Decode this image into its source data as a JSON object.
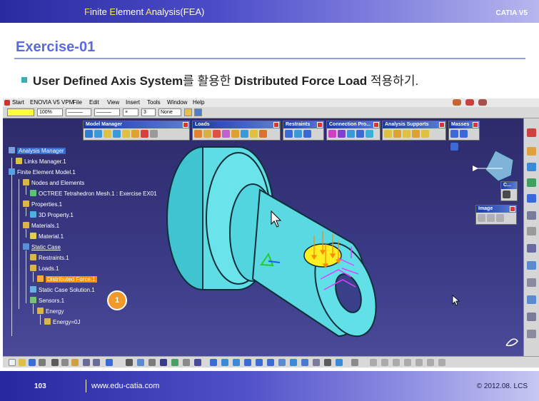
{
  "slide": {
    "header_title_parts": [
      {
        "text": "F",
        "hl": true
      },
      {
        "text": "inite ",
        "hl": false
      },
      {
        "text": "E",
        "hl": true
      },
      {
        "text": "lement ",
        "hl": false
      },
      {
        "text": "A",
        "hl": true
      },
      {
        "text": "nalysis(FEA)",
        "hl": false
      }
    ],
    "brand": "CATIA V5",
    "exercise_title": "Exercise-01",
    "bullet": {
      "part1": "User Defined Axis System",
      "part2": "를 활용한 ",
      "part3": "Distributed Force Load",
      "part4": " 적용하기."
    },
    "page_number": "103",
    "website": "www.edu-catia.com",
    "copyright": "© 2012.08. LCS"
  },
  "catia": {
    "menu": [
      "Start",
      "ENOVIA V5 VPM",
      "File",
      "Edit",
      "View",
      "Insert",
      "Tools",
      "Window",
      "Help"
    ],
    "toolbar": {
      "zoom": "100%",
      "layer": "3",
      "filter": "None"
    },
    "palettes": [
      {
        "title": "Model Manager",
        "icons": 8
      },
      {
        "title": "Loads",
        "icons": 10
      },
      {
        "title": "Restraints",
        "icons": 4
      },
      {
        "title": "Connection Pro...",
        "icons": 5
      },
      {
        "title": "Analysis Supports",
        "icons": 6
      },
      {
        "title": "Masses",
        "icons": 3
      },
      {
        "title": "C...",
        "icons": 1
      },
      {
        "title": "Image",
        "icons": 3
      }
    ],
    "tree": [
      {
        "label": "Analysis Manager"
      },
      {
        "label": "Links Manager.1"
      },
      {
        "label": "Finite Element Model.1"
      },
      {
        "label": "Nodes and Elements"
      },
      {
        "label": "OCTREE Tetrahedron Mesh.1 : Exercise EX01"
      },
      {
        "label": "Properties.1"
      },
      {
        "label": "3D Property.1"
      },
      {
        "label": "Materials.1"
      },
      {
        "label": "Material.1"
      },
      {
        "label": "Static Case"
      },
      {
        "label": "Restraints.1"
      },
      {
        "label": "Loads.1"
      },
      {
        "label": "Distributed Force.1"
      },
      {
        "label": "Static Case Solution.1"
      },
      {
        "label": "Sensors.1"
      },
      {
        "label": "Energy"
      },
      {
        "label": "Energy=0J"
      }
    ],
    "callout": "1"
  },
  "colors": {
    "viewport": "#2e2c6e",
    "part": "#5ee0e8",
    "selected_node": "#ff8d00",
    "force_arrows": "#ff8800",
    "axis": "#e040ff",
    "face": "#ffee22"
  }
}
